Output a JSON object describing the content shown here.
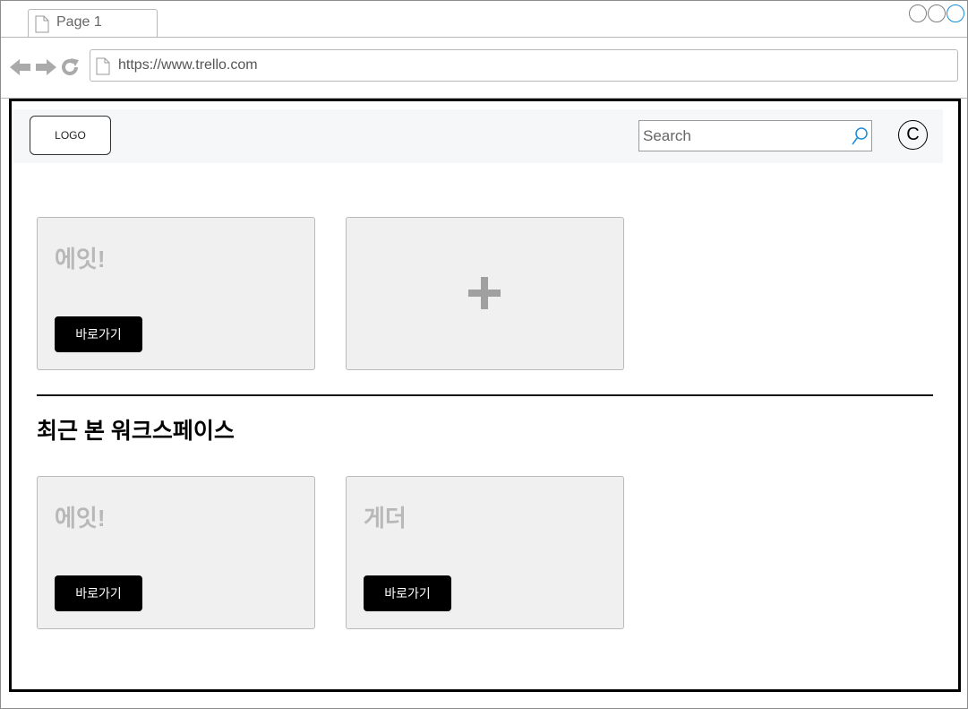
{
  "browser": {
    "tab_title": "Page 1",
    "url": "https://www.trello.com"
  },
  "header": {
    "logo_text": "LOGO",
    "search_placeholder": "Search",
    "avatar_letter": "C"
  },
  "workspaces": [
    {
      "title": "에잇!",
      "button_label": "바로가기"
    }
  ],
  "recent": {
    "section_title": "최근 본 워크스페이스",
    "workspaces": [
      {
        "title": "에잇!",
        "button_label": "바로가기"
      },
      {
        "title": "게더",
        "button_label": "바로가기"
      }
    ]
  },
  "icons": {
    "add": "plus-icon",
    "search": "search-icon",
    "page": "page-icon"
  },
  "colors": {
    "button_bg": "#000000",
    "card_bg": "#f0f0f0",
    "card_title": "#b8b8b8",
    "header_bg": "#f6f7f8",
    "accent_blue": "#1a8cd8"
  }
}
